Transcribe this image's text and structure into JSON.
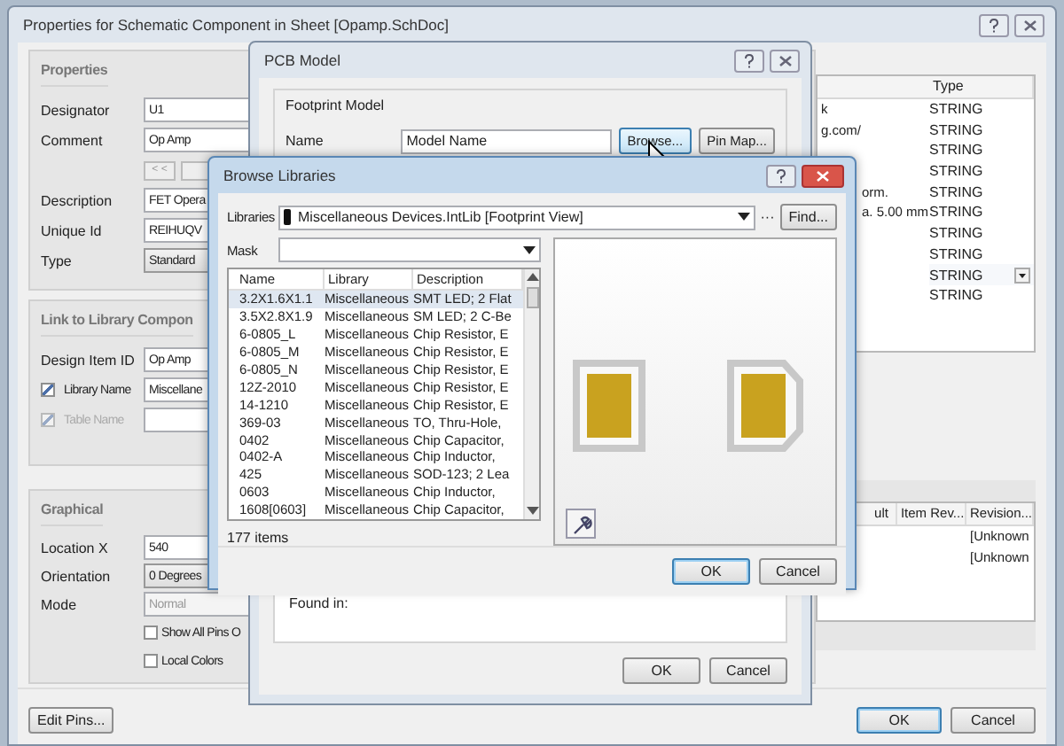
{
  "main_window": {
    "title": "Properties for Schematic Component in Sheet [Opamp.SchDoc]",
    "properties": {
      "heading": "Properties",
      "rows": [
        {
          "kind": "text",
          "label": "Designator",
          "value": "U1"
        },
        {
          "kind": "text",
          "label": "Comment",
          "value": "Op Amp"
        },
        {
          "kind": "buttons",
          "buttons": [
            "< <"
          ]
        },
        {
          "kind": "text",
          "label": "Description",
          "value": "FET Opera"
        },
        {
          "kind": "text",
          "label": "Unique Id",
          "value": "REIHUQV"
        },
        {
          "kind": "dropdown",
          "label": "Type",
          "value": "Standard"
        }
      ]
    },
    "library_link": {
      "heading": "Link to Library Compon",
      "rows": [
        {
          "kind": "text",
          "label": "Design Item ID",
          "value": "Op Amp"
        },
        {
          "kind": "checkbox",
          "label": "Library Name",
          "checked": true,
          "disabled": false,
          "value": "Miscellane"
        },
        {
          "kind": "checkbox",
          "label": "Table Name",
          "checked": true,
          "disabled": true
        }
      ]
    },
    "graphical": {
      "heading": "Graphical",
      "rows": [
        {
          "kind": "text",
          "label": "Location X",
          "value": "540"
        },
        {
          "kind": "dropdown",
          "label": "Orientation",
          "value": "0 Degrees"
        },
        {
          "kind": "text",
          "label": "Mode",
          "value": "Normal",
          "disabled": true
        },
        {
          "kind": "check",
          "label": "Show All Pins O",
          "checked": false
        },
        {
          "kind": "check",
          "label": "Local Colors",
          "checked": false
        }
      ]
    },
    "parameters": {
      "columns": [
        "Type"
      ],
      "rows": [
        {
          "column_1": "k",
          "type": "STRING",
          "dropdown": false
        },
        {
          "column_1": "g.com/",
          "type": "STRING",
          "dropdown": false
        },
        {
          "type": "STRING",
          "dropdown": false
        },
        {
          "type": "STRING",
          "dropdown": false
        },
        {
          "column_1": "orm.",
          "type": "STRING",
          "dropdown": false
        },
        {
          "column_1": "a. 5.00 mm",
          "type": "STRING",
          "dropdown": false
        },
        {
          "type": "STRING",
          "dropdown": false
        },
        {
          "type": "STRING",
          "dropdown": false
        },
        {
          "type": "STRING",
          "dropdown": true
        },
        {
          "type": "STRING",
          "dropdown": false
        }
      ]
    },
    "models": {
      "columns": [
        "ult",
        "Item Rev...",
        "Revision..."
      ],
      "rows": [
        {
          "revision": "[Unknown"
        },
        {
          "revision": "[Unknown"
        }
      ]
    },
    "buttons": {
      "left": "Edit Pins...",
      "ok": "OK",
      "cancel": "Cancel"
    }
  },
  "pcb_model": {
    "title": "PCB Model",
    "group": "Footprint Model",
    "name_label": "Name",
    "name_value": "Model Name",
    "browse": "Browse...",
    "pin_map": "Pin Map...",
    "found_in": "Found in:",
    "ok": "OK",
    "cancel": "Cancel"
  },
  "browse_libraries": {
    "title": "Browse Libraries",
    "libraries_label": "Libraries",
    "library": "Miscellaneous Devices.IntLib [Footprint View]",
    "more": "···",
    "find": "Find...",
    "mask_label": "Mask",
    "columns": [
      "Name",
      "Library",
      "Description"
    ],
    "rows": [
      {
        "name": "3.2X1.6X1.1",
        "library": "Miscellaneous",
        "description": "SMT LED; 2 Flat",
        "selected": true
      },
      {
        "name": "3.5X2.8X1.9",
        "library": "Miscellaneous",
        "description": "SM LED; 2 C-Be",
        "selected": false
      },
      {
        "name": "6-0805_L",
        "library": "Miscellaneous",
        "description": "Chip Resistor, E",
        "selected": false
      },
      {
        "name": "6-0805_M",
        "library": "Miscellaneous",
        "description": "Chip Resistor, E",
        "selected": false
      },
      {
        "name": "6-0805_N",
        "library": "Miscellaneous",
        "description": "Chip Resistor, E",
        "selected": false
      },
      {
        "name": "12Z-2010",
        "library": "Miscellaneous",
        "description": "Chip Resistor, E",
        "selected": false
      },
      {
        "name": "14-1210",
        "library": "Miscellaneous",
        "description": "Chip Resistor, E",
        "selected": false
      },
      {
        "name": "369-03",
        "library": "Miscellaneous",
        "description": "TO, Thru-Hole,",
        "selected": false
      },
      {
        "name": "0402",
        "library": "Miscellaneous",
        "description": "Chip Capacitor,",
        "selected": false
      },
      {
        "name": "0402-A",
        "library": "Miscellaneous",
        "description": "Chip Inductor,",
        "selected": false
      },
      {
        "name": "425",
        "library": "Miscellaneous",
        "description": "SOD-123; 2 Lea",
        "selected": false
      },
      {
        "name": "0603",
        "library": "Miscellaneous",
        "description": "Chip Inductor,",
        "selected": false
      },
      {
        "name": "1608[0603]",
        "library": "Miscellaneous",
        "description": "Chip Capacitor,",
        "selected": false
      }
    ],
    "count": "177 items",
    "ok": "OK",
    "cancel": "Cancel"
  }
}
